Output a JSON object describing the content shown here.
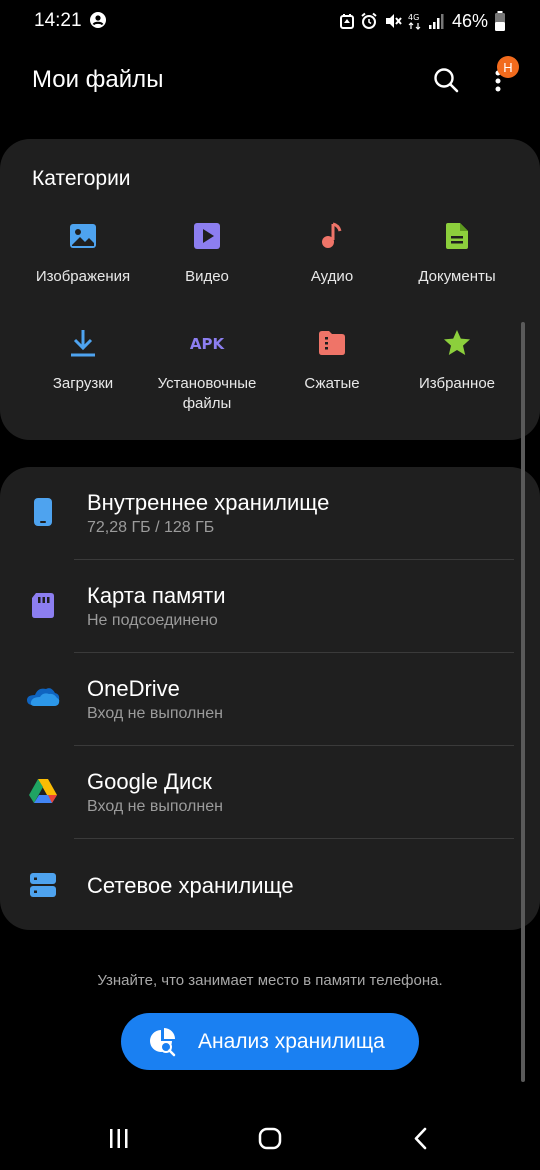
{
  "status_bar": {
    "time": "14:21",
    "battery": "46%",
    "icons": [
      "account-icon",
      "app-notification-icon",
      "alarm-icon",
      "mute-icon",
      "4g-icon",
      "signal-icon",
      "battery-icon"
    ]
  },
  "header": {
    "title": "Мои файлы",
    "badge": "H"
  },
  "categories": {
    "title": "Категории",
    "items": [
      {
        "label": "Изображения",
        "icon": "image-icon",
        "color": "#4ea3ef"
      },
      {
        "label": "Видео",
        "icon": "video-icon",
        "color": "#8c7ef0"
      },
      {
        "label": "Аудио",
        "icon": "music-note-icon",
        "color": "#ef7468"
      },
      {
        "label": "Документы",
        "icon": "document-icon",
        "color": "#8ccf3c"
      },
      {
        "label": "Загрузки",
        "icon": "download-icon",
        "color": "#4ea3ef"
      },
      {
        "label": "Установочные файлы",
        "icon": "apk-icon",
        "icon_text": "APK",
        "color": "#8c7ef0"
      },
      {
        "label": "Сжатые",
        "icon": "archive-icon",
        "color": "#ef7468"
      },
      {
        "label": "Избранное",
        "icon": "star-icon",
        "color": "#8ccf3c"
      }
    ]
  },
  "storage": {
    "items": [
      {
        "name": "Внутреннее хранилище",
        "sub": "72,28 ГБ / 128 ГБ",
        "icon": "phone-icon",
        "color": "#4ea3ef"
      },
      {
        "name": "Карта памяти",
        "sub": "Не подсоединено",
        "icon": "sd-card-icon",
        "color": "#8c7ef0"
      },
      {
        "name": "OneDrive",
        "sub": "Вход не выполнен",
        "icon": "onedrive-icon",
        "color": "#1a7fd6"
      },
      {
        "name": "Google Диск",
        "sub": "Вход не выполнен",
        "icon": "google-drive-icon",
        "color": "#34a853"
      },
      {
        "name": "Сетевое хранилище",
        "sub": "",
        "icon": "network-storage-icon",
        "color": "#4ea3ef"
      }
    ]
  },
  "hint": "Узнайте, что занимает место в памяти телефона.",
  "analyze_button": "Анализ хранилища",
  "colors": {
    "background": "#000000",
    "card": "#1f1f1f",
    "accent": "#1a80f2",
    "badge": "#f26b1d"
  }
}
